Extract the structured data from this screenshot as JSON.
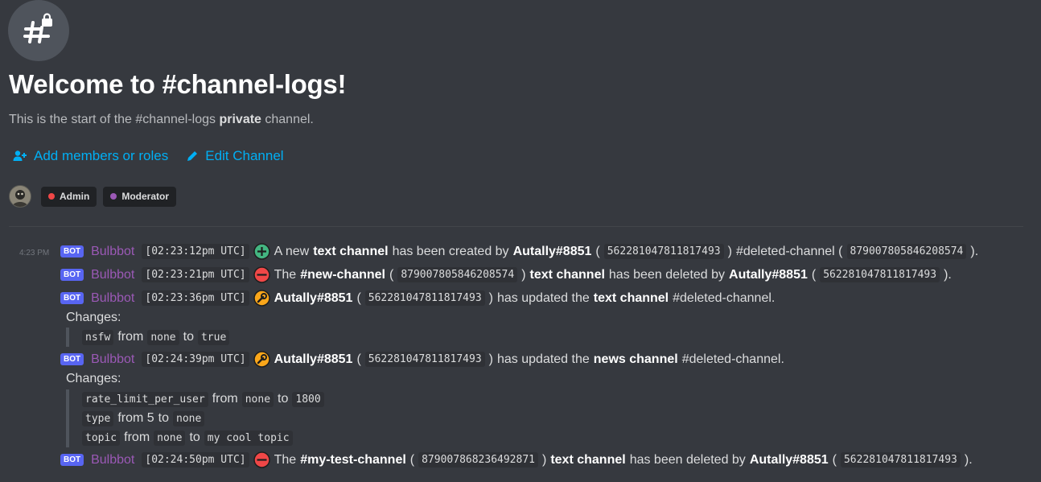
{
  "header": {
    "title": "Welcome to #channel-logs!",
    "subtitle_pre": "This is the start of the #channel-logs ",
    "subtitle_bold": "private",
    "subtitle_post": " channel.",
    "add_members": "Add members or roles",
    "edit_channel": "Edit Channel"
  },
  "roles": [
    {
      "name": "Admin",
      "color": "#f04747"
    },
    {
      "name": "Moderator",
      "color": "#9b59b6"
    }
  ],
  "colors": {
    "accent": "#00aff4",
    "bot_tag": "#5865f2",
    "author": "#9b59b6"
  },
  "messages": {
    "side_time": "4:23 PM",
    "bot_tag": "BOT",
    "author": "Bulbbot",
    "m1": {
      "time": "[02:23:12pm UTC]",
      "icon": "plus-circle-icon",
      "t1": "A new ",
      "b1": "text channel",
      "t2": " has been created by ",
      "b2": "Autally#8851",
      "c1": "562281047811817493",
      "t3": " #deleted-channel (",
      "c2": "879007805846208574",
      "t4": ")."
    },
    "m2": {
      "time": "[02:23:21pm UTC]",
      "icon": "minus-circle-icon",
      "t1": "The ",
      "b1": "#new-channel",
      "t2": " (",
      "c1": "879007805846208574",
      "t3": ") ",
      "b2": "text channel",
      "t4": " has been deleted by ",
      "b3": "Autally#8851",
      "c2": "562281047811817493",
      "t5": ")."
    },
    "m3": {
      "time": "[02:23:36pm UTC]",
      "icon": "wrench-icon",
      "b1": "Autally#8851",
      "c1": "562281047811817493",
      "t1": " has updated the ",
      "b2": "text channel",
      "t2": " #deleted-channel.",
      "changes_label": "Changes:",
      "changes": [
        {
          "field": "nsfw",
          "from": "from",
          "old": "none",
          "to": "to",
          "new": "true"
        }
      ]
    },
    "m4": {
      "time": "[02:24:39pm UTC]",
      "icon": "wrench-icon",
      "b1": "Autally#8851",
      "c1": "562281047811817493",
      "t1": " has updated the ",
      "b2": "news channel",
      "t2": " #deleted-channel.",
      "changes_label": "Changes:",
      "changes": [
        {
          "field": "rate_limit_per_user",
          "from": "from",
          "old": "none",
          "to": "to",
          "new": "1800"
        },
        {
          "field": "type",
          "from": "from 5",
          "to": "to",
          "new": "none"
        },
        {
          "field": "topic",
          "from": "from",
          "old": "none",
          "to": "to",
          "new": "my cool topic"
        }
      ]
    },
    "m5": {
      "time": "[02:24:50pm UTC]",
      "icon": "minus-circle-icon",
      "t1": "The ",
      "b1": "#my-test-channel",
      "t2": " (",
      "c1": "879007868236492871",
      "t3": ") ",
      "b2": "text channel",
      "t4": " has been deleted by ",
      "b3": "Autally#8851",
      "c2": "562281047811817493",
      "t5": ")."
    }
  }
}
